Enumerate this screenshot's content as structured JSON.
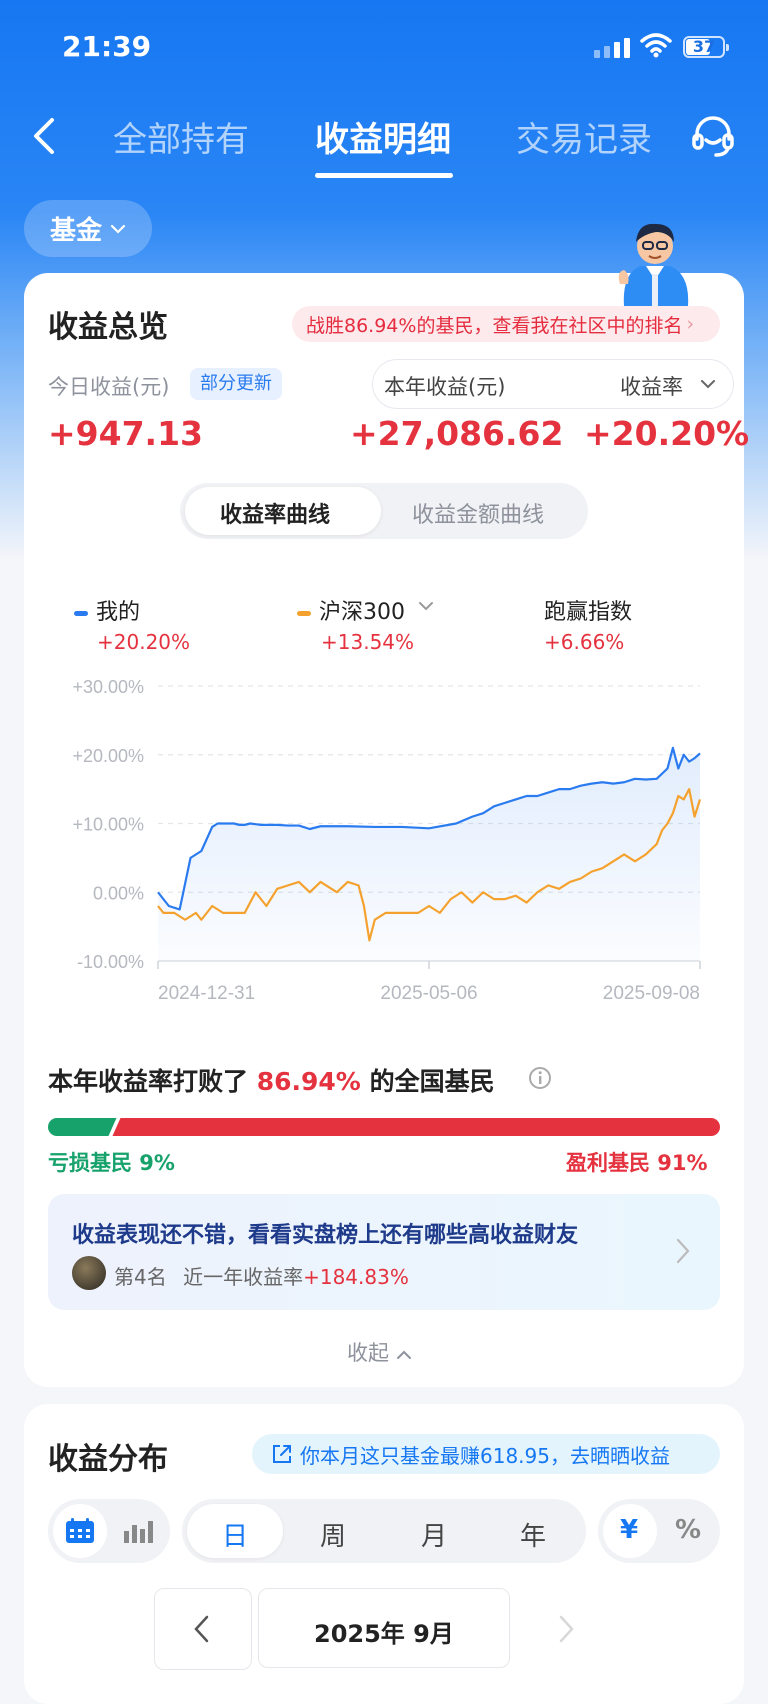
{
  "status_bar": {
    "time": "21:39",
    "battery": "37"
  },
  "nav": {
    "tabs": [
      "全部持有",
      "收益明细",
      "交易记录"
    ],
    "active_tab": "收益明细",
    "back_icon": "chevron-left-icon",
    "service_icon": "headset-icon"
  },
  "filter": {
    "label": "基金"
  },
  "overview": {
    "title": "收益总览",
    "rank_banner": "战胜86.94%的基民，查看我在社区中的排名",
    "today_label": "今日收益(元)",
    "today_badge": "部分更新",
    "today_value": "+947.13",
    "year_selector": "本年收益(元)",
    "rate_selector": "收益率",
    "year_value": "+27,086.62",
    "rate_value": "+20.20%"
  },
  "chart_toggle": {
    "options": [
      "收益率曲线",
      "收益金额曲线"
    ],
    "active": "收益率曲线"
  },
  "legend": {
    "mine_label": "我的",
    "mine_value": "+20.20%",
    "index_label": "沪深300",
    "index_value": "+13.54%",
    "beat_label": "跑赢指数",
    "beat_value": "+6.66%"
  },
  "chart_data": {
    "type": "line",
    "y_ticks": [
      "+30.00%",
      "+20.00%",
      "+10.00%",
      "0.00%",
      "-10.00%"
    ],
    "x_tick_labels": [
      "2024-12-31",
      "2025-05-06",
      "2025-09-08"
    ],
    "ylim": [
      -10,
      30
    ],
    "series": [
      {
        "name": "我的",
        "color": "#2a7bf0",
        "x": [
          0,
          2,
          4,
          6,
          8,
          10,
          11,
          12,
          13,
          14,
          15,
          16,
          17,
          18,
          19,
          20,
          22,
          24,
          26,
          28,
          30,
          35,
          40,
          45,
          50,
          55,
          58,
          60,
          62,
          64,
          66,
          68,
          70,
          72,
          74,
          76,
          78,
          80,
          82,
          84,
          86,
          88,
          90,
          92,
          94,
          95,
          96,
          97,
          98,
          99,
          100
        ],
        "values": [
          0,
          -2,
          -2.5,
          5,
          6,
          9.5,
          10,
          10,
          10,
          10,
          9.8,
          9.8,
          10,
          9.9,
          9.8,
          9.8,
          9.8,
          9.7,
          9.7,
          9.2,
          9.6,
          9.6,
          9.5,
          9.5,
          9.3,
          10,
          11,
          11.5,
          12.5,
          13,
          13.5,
          14,
          14,
          14.5,
          15,
          15,
          15.5,
          15.8,
          16,
          15.8,
          16,
          16.5,
          16.4,
          16.5,
          18,
          21,
          18,
          20,
          19,
          19.5,
          20.2
        ]
      },
      {
        "name": "沪深300",
        "color": "#f5a12e",
        "x": [
          0,
          1,
          3,
          5,
          7,
          8,
          10,
          12,
          14,
          16,
          18,
          20,
          22,
          24,
          26,
          28,
          30,
          33,
          35,
          37,
          38,
          39,
          40,
          42,
          45,
          48,
          50,
          52,
          54,
          56,
          58,
          60,
          62,
          64,
          66,
          68,
          70,
          72,
          74,
          76,
          78,
          80,
          82,
          84,
          86,
          88,
          90,
          92,
          93,
          94,
          95,
          96,
          97,
          98,
          99,
          100
        ],
        "values": [
          -2,
          -3,
          -3,
          -4,
          -3,
          -4,
          -2,
          -3,
          -3,
          -3,
          0,
          -2,
          0.5,
          1,
          1.5,
          0,
          1.5,
          0,
          1.5,
          1,
          -2,
          -7,
          -4,
          -3,
          -3,
          -3,
          -2,
          -3,
          -1,
          0,
          -1.5,
          0,
          -1,
          -1,
          -0.5,
          -1.5,
          0,
          1,
          0.5,
          1.5,
          2,
          3,
          3.5,
          4.5,
          5.5,
          4.5,
          5.5,
          7,
          9,
          10,
          11.5,
          14,
          13.5,
          15,
          11,
          13.5
        ]
      }
    ]
  },
  "beat_section": {
    "prefix": "本年收益率打败了",
    "percent": "86.94%",
    "suffix": "的全国基民",
    "loss_label": "亏损基民 9%",
    "profit_label": "盈利基民 91%",
    "loss_share": 0.09,
    "loss_color": "#17a26b",
    "profit_color": "#e5323f"
  },
  "promo": {
    "title": "收益表现还不错，看看实盘榜上还有哪些高收益财友",
    "rank": "第4名",
    "desc": "近一年收益率",
    "value": "+184.83%"
  },
  "collapse_label": "收起",
  "distribution": {
    "title": "收益分布",
    "promo_text": "你本月这只基金最赚618.95，去晒晒收益",
    "periods": [
      "日",
      "周",
      "月",
      "年"
    ],
    "active_period": "日",
    "units": [
      "¥",
      "%"
    ],
    "active_unit": "¥",
    "month": "2025年 9月"
  },
  "colors": {
    "brand_blue": "#1677f2",
    "up_red": "#e5323f",
    "down_green": "#17a26b"
  }
}
